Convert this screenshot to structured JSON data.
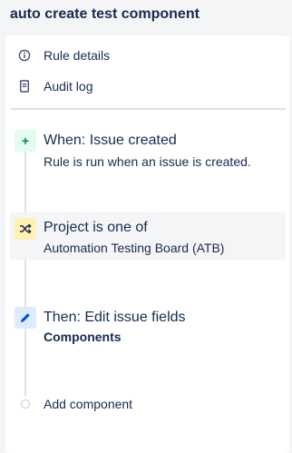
{
  "page_title": "auto create test component",
  "menu": {
    "rule_details": {
      "label": "Rule details",
      "icon": "info-icon"
    },
    "audit_log": {
      "label": "Audit log",
      "icon": "document-icon"
    }
  },
  "steps": [
    {
      "title": "When: Issue created",
      "subtitle": "Rule is run when an issue is created.",
      "icon": "plus-icon",
      "icon_glyph": "+",
      "icon_bg": "#e3fcef",
      "icon_color": "#00875a"
    },
    {
      "title": "Project is one of",
      "subtitle": "Automation Testing Board (ATB)",
      "icon": "shuffle-icon",
      "icon_glyph": "⤮",
      "icon_bg": "#fff0b3",
      "icon_color": "#172b4d"
    },
    {
      "title": "Then: Edit issue fields",
      "subtitle": "Components",
      "icon": "pencil-icon",
      "icon_glyph": "✎",
      "icon_bg": "#deebff",
      "icon_color": "#0052cc"
    }
  ],
  "add_component": {
    "label": "Add component"
  }
}
